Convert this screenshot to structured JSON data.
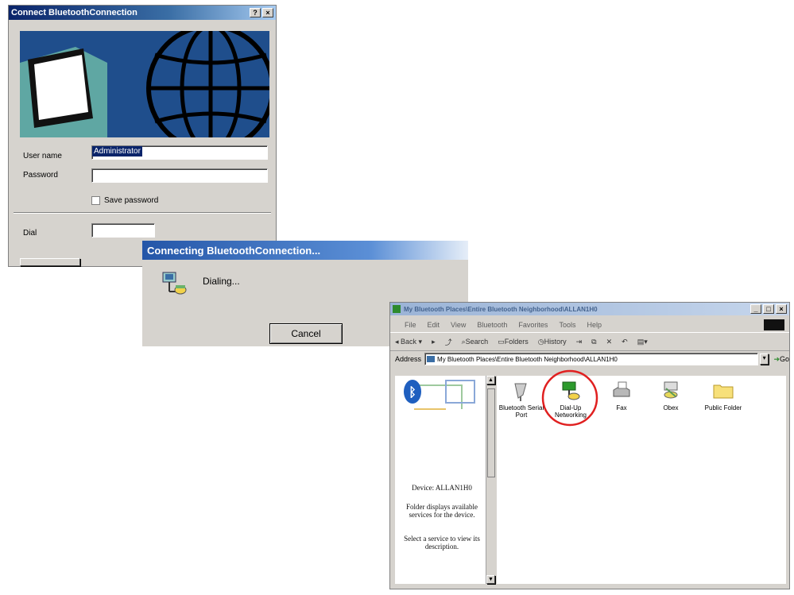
{
  "connect_dialog": {
    "title": "Connect BluetoothConnection",
    "help_btn": "?",
    "close_btn": "×",
    "user_name_label": "User name",
    "user_name_value": "Administrator",
    "password_label": "Password",
    "save_password_label": "Save password",
    "dial_label": "Dial"
  },
  "connecting_dialog": {
    "title": "Connecting BluetoothConnection...",
    "status": "Dialing...",
    "cancel_label": "Cancel"
  },
  "explorer": {
    "title": "My Bluetooth Places\\Entire Bluetooth Neighborhood\\ALLAN1H0",
    "menu": [
      "File",
      "Edit",
      "View",
      "Bluetooth",
      "Favorites",
      "Tools",
      "Help"
    ],
    "toolbar": [
      "Back",
      "Search",
      "Folders",
      "History"
    ],
    "address_label": "Address",
    "address_value": "My Bluetooth Places\\Entire Bluetooth Neighborhood\\ALLAN1H0",
    "go_label": "Go",
    "items": [
      {
        "label": "Bluetooth Serial Port",
        "icon": "serial-port-icon"
      },
      {
        "label": "Dial-Up Networking",
        "icon": "dialup-networking-icon",
        "highlighted": true
      },
      {
        "label": "Fax",
        "icon": "fax-icon"
      },
      {
        "label": "Obex",
        "icon": "obex-icon"
      },
      {
        "label": "Public Folder",
        "icon": "folder-icon"
      }
    ],
    "left_pane": {
      "device": "Device: ALLAN1H0",
      "description": "Folder displays available services for the device.",
      "hint": "Select a service to view its description."
    },
    "highlight_color": "#e02020"
  }
}
